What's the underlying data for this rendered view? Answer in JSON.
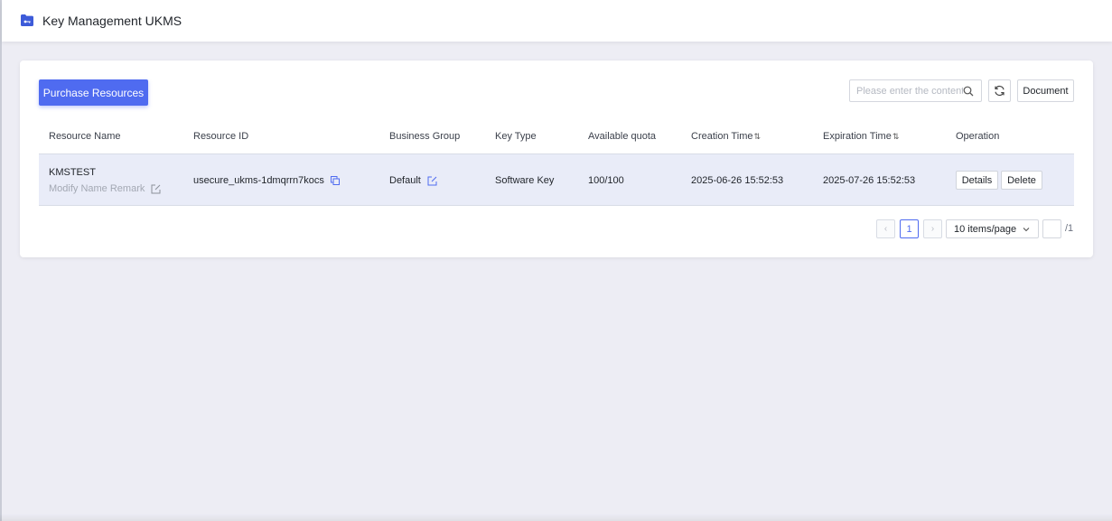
{
  "header": {
    "title": "Key Management UKMS",
    "icon": "folder-key-icon"
  },
  "toolbar": {
    "purchase_label": "Purchase Resources",
    "search_placeholder": "Please enter the content",
    "search_value": "",
    "refresh_icon": "refresh-icon",
    "document_label": "Document"
  },
  "table": {
    "columns": [
      "Resource Name",
      "Resource ID",
      "Business Group",
      "Key Type",
      "Available quota",
      "Creation Time",
      "Expiration Time",
      "Operation"
    ],
    "sortable_columns": [
      "Creation Time",
      "Expiration Time"
    ],
    "rows": [
      {
        "name": "KMSTEST",
        "remark": "Modify Name Remark",
        "resource_id": "usecure_ukms-1dmqrrn7kocs",
        "business_group": "Default",
        "key_type": "Software Key",
        "quota": "100/100",
        "creation_time": "2025-06-26 15:52:53",
        "expiration_time": "2025-07-26 15:52:53",
        "operations": [
          "Details",
          "Delete"
        ]
      }
    ]
  },
  "pagination": {
    "prev": "‹",
    "next": "›",
    "current_page": "1",
    "page_size": "10 items/page",
    "jump_value": "",
    "total": "/1"
  },
  "colors": {
    "primary": "#4f6bf0",
    "row_highlight": "#e9ecf8",
    "background": "#ededf4"
  }
}
